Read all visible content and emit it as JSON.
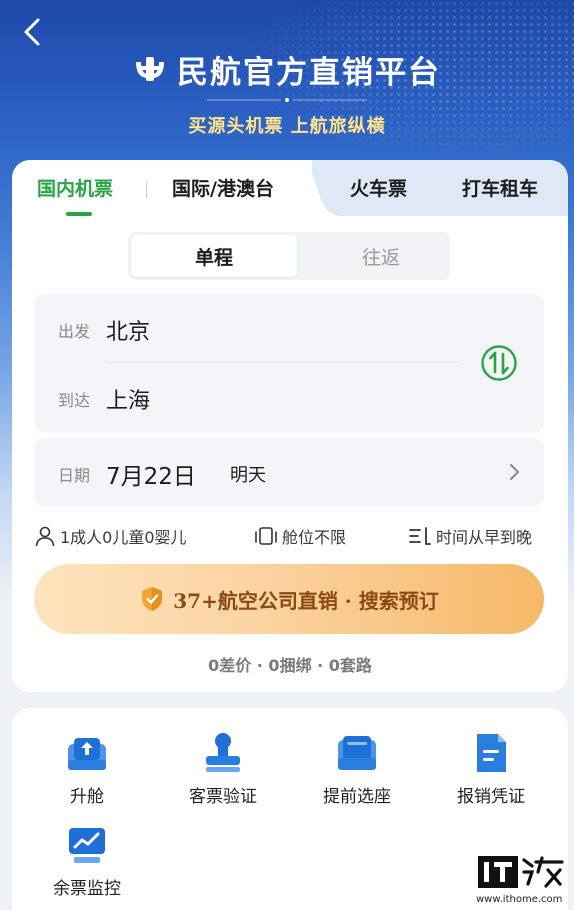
{
  "header": {
    "brand_title": "民航官方直销平台",
    "slogan": "买源头机票 上航旅纵横"
  },
  "tabs": [
    {
      "label": "国内机票",
      "active": true
    },
    {
      "label": "国际/港澳台",
      "active": false
    },
    {
      "label": "火车票",
      "active": false
    },
    {
      "label": "打车租车",
      "active": false
    }
  ],
  "trip_type": {
    "one_way": "单程",
    "round_trip": "往返",
    "selected": "单程"
  },
  "route": {
    "depart_label": "出发",
    "depart_city": "北京",
    "arrive_label": "到达",
    "arrive_city": "上海"
  },
  "date": {
    "label": "日期",
    "value": "7月22日",
    "relative": "明天"
  },
  "options": {
    "passengers": "1成人0儿童0婴儿",
    "cabin": "舱位不限",
    "sort": "时间从早到晚"
  },
  "search_button": "37+航空公司直销 · 搜索预订",
  "promise": "0差价 · 0捆绑 · 0套路",
  "services": [
    {
      "label": "升舱",
      "icon": "upgrade-seat-icon"
    },
    {
      "label": "客票验证",
      "icon": "ticket-verify-stamp-icon"
    },
    {
      "label": "提前选座",
      "icon": "seat-select-icon"
    },
    {
      "label": "报销凭证",
      "icon": "receipt-document-icon"
    },
    {
      "label": "余票监控",
      "icon": "ticket-monitor-chart-icon"
    }
  ],
  "watermark": {
    "brand": "IT之家",
    "url": "www.ithome.com"
  },
  "colors": {
    "accent_green": "#2aa545",
    "hero_blue": "#2a5fc2",
    "slogan_gold": "#ffe38a",
    "search_text": "#8b4a14"
  }
}
